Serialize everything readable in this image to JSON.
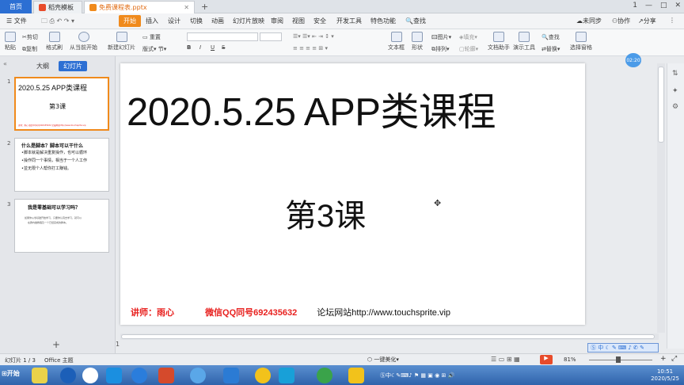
{
  "tabs": {
    "home": "首页",
    "template": "稻壳模板",
    "doc": "免费课程表.pptx",
    "plus": "+"
  },
  "window": {
    "page_num": "1",
    "min": "—",
    "max": "□",
    "close": "✕"
  },
  "menu": {
    "file": "文件",
    "start": "开始",
    "insert": "插入",
    "design": "设计",
    "transition": "切换",
    "animation": "动画",
    "slideshow": "幻灯片放映",
    "review": "审阅",
    "view": "视图",
    "security": "安全",
    "developer": "开发工具",
    "special": "特色功能",
    "search": "查找",
    "sync": "未同步",
    "collab": "协作",
    "share": "分享"
  },
  "ribbon": {
    "paste": "粘贴",
    "cut": "剪切",
    "copy": "复制",
    "format": "格式刷",
    "from_current": "从当前开始",
    "new_slide": "新建幻灯片",
    "layout": "版式",
    "section": "节",
    "reset": "重置",
    "bold": "B",
    "italic": "I",
    "underline": "U",
    "strike": "S",
    "textbox": "文本框",
    "shape": "形状",
    "arrange": "排列",
    "picture": "图片",
    "fill": "填充",
    "outline": "轮廓",
    "doc_helper": "文档助手",
    "present_tool": "演示工具",
    "find": "查找",
    "replace": "替换",
    "select_pane": "选择窗格"
  },
  "panel": {
    "outline_tab": "大纲",
    "slides_tab": "幻灯片"
  },
  "thumbs": [
    {
      "num": "1",
      "title": "2020.5.25  APP类课程",
      "sub": "第3课",
      "foot": "讲师：雨心  微信QQ同号692435632  论坛网站http://www.touchsprite.vip"
    },
    {
      "num": "2",
      "title": "什么是脚本？脚本可以干什么",
      "l1": "•脚本就是解决重复操作，也可以循环",
      "l2": "•操作同一个事情，相当于一个人工作",
      "l3": "•並无限个人帮你打工赚钱。"
    },
    {
      "num": "3",
      "title": "我是零基础可以学习吗？",
      "l1": "如果你从零基础开始学习，只要你认真去学习，就可以",
      "l2": "在群内做教程及一个已经完成的脚本。"
    }
  ],
  "slide": {
    "title": "2020.5.25  APP类课程",
    "subtitle": "第3课",
    "teacher": "讲师：雨心",
    "wechat": "微信QQ同号692435632",
    "forum": "论坛网站http://www.touchsprite.vip"
  },
  "status": {
    "slide_info": "幻灯片 1 / 3",
    "theme": "Office 主题",
    "beautify": "一键美化",
    "zoom": "81%",
    "add": "+",
    "page": "1"
  },
  "clock": {
    "time": "10:51",
    "date": "2020/5/25"
  },
  "taskbar": {
    "start": "开始"
  },
  "badge": "02:20",
  "colors": {
    "accent": "#f08a1c",
    "blue": "#2c6fd3",
    "footer_red": "#e8201e"
  }
}
